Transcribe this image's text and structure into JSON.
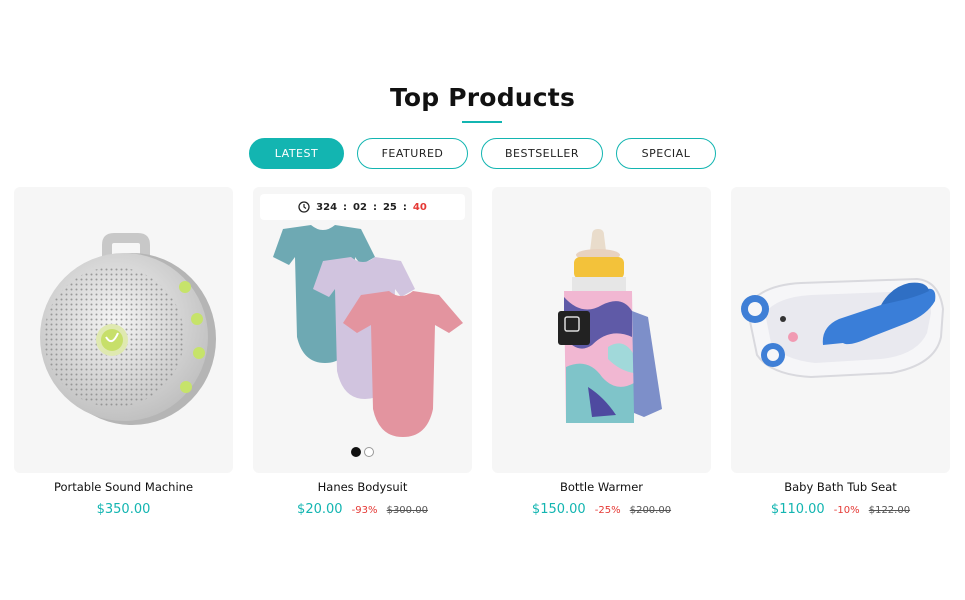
{
  "section": {
    "title": "Top Products"
  },
  "tabs": [
    {
      "label": "LATEST",
      "active": true
    },
    {
      "label": "FEATURED",
      "active": false
    },
    {
      "label": "BESTSELLER",
      "active": false
    },
    {
      "label": "SPECIAL",
      "active": false
    }
  ],
  "products": [
    {
      "name": "Portable Sound Machine",
      "price": "$350.00",
      "discount": "",
      "old_price": "",
      "image_icon": "sound-machine-icon"
    },
    {
      "name": "Hanes Bodysuit",
      "price": "$20.00",
      "discount": "-93%",
      "old_price": "$300.00",
      "image_icon": "bodysuit-icon",
      "countdown": {
        "days": "324",
        "hours": "02",
        "minutes": "25",
        "seconds": "40"
      },
      "carousel_dots": 2,
      "active_dot": 0
    },
    {
      "name": "Bottle Warmer",
      "price": "$150.00",
      "discount": "-25%",
      "old_price": "$200.00",
      "image_icon": "bottle-warmer-icon"
    },
    {
      "name": "Baby Bath Tub Seat",
      "price": "$110.00",
      "discount": "-10%",
      "old_price": "$122.00",
      "image_icon": "bath-tub-icon"
    }
  ],
  "colors": {
    "accent": "#13b5b1",
    "sale": "#e53935",
    "card_bg": "#f6f6f6"
  }
}
